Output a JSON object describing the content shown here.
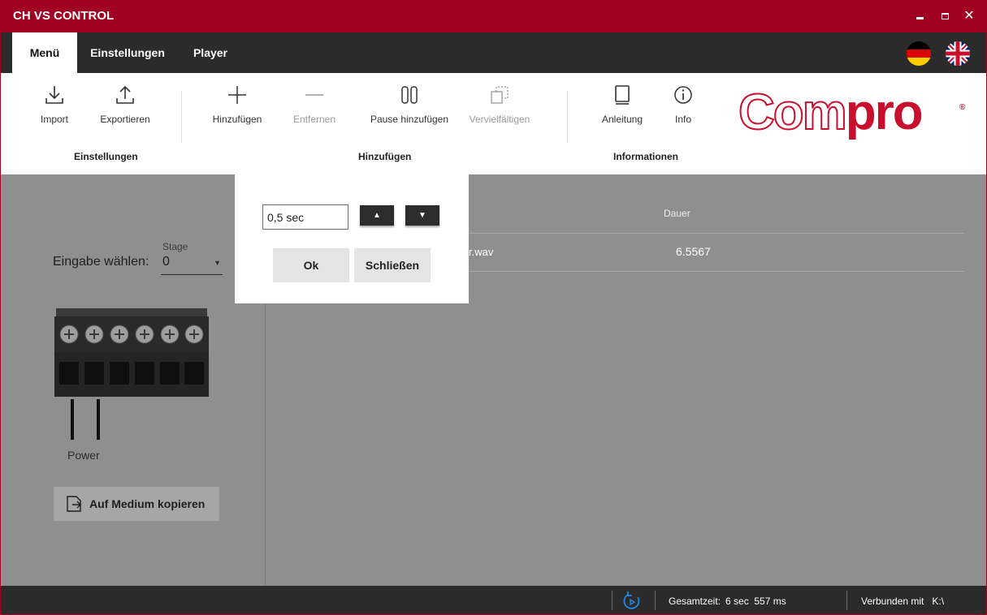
{
  "window": {
    "title": "CH VS CONTROL"
  },
  "tabs": [
    {
      "label": "Menü",
      "active": true
    },
    {
      "label": "Einstellungen",
      "active": false
    },
    {
      "label": "Player",
      "active": false
    }
  ],
  "languages": [
    {
      "icon": "flag-germany-icon"
    },
    {
      "icon": "flag-uk-icon"
    }
  ],
  "ribbon": {
    "groups": [
      {
        "label": "Einstellungen",
        "buttons": [
          {
            "label": "Import",
            "icon": "download-icon"
          },
          {
            "label": "Exportieren",
            "icon": "upload-icon"
          }
        ]
      },
      {
        "label": "Hinzufügen",
        "buttons": [
          {
            "label": "Hinzufügen",
            "icon": "plus-icon"
          },
          {
            "label": "Entfernen",
            "icon": "minus-icon",
            "disabled": true
          },
          {
            "label": "Pause hinzufügen",
            "icon": "pause-icon"
          },
          {
            "label": "Vervielfältigen",
            "icon": "duplicate-icon",
            "disabled": true
          }
        ]
      },
      {
        "label": "Informationen",
        "buttons": [
          {
            "label": "Anleitung",
            "icon": "book-icon"
          },
          {
            "label": "Info",
            "icon": "info-icon"
          }
        ]
      }
    ]
  },
  "logo": {
    "outline": "Com",
    "solid": "pro",
    "mark": "®"
  },
  "left_panel": {
    "stage_label": "Stage",
    "input_label": "Eingabe wählen:",
    "input_value": "0",
    "power_label": "Power",
    "copy_button": "Auf Medium kopieren"
  },
  "table": {
    "columns": [
      "Dauer"
    ],
    "rows": [
      {
        "name_fragment": "r.wav",
        "duration": "6.5567"
      }
    ]
  },
  "dialog": {
    "value": "0,5 sec",
    "up": "^",
    "down": "v",
    "ok": "Ok",
    "close": "Schließen"
  },
  "status": {
    "total_label": "Gesamtzeit:",
    "total_value": "6 sec  557 ms",
    "connected_label": "Verbunden mit",
    "connected_value": "K:\\"
  },
  "colors": {
    "accent": "#a00022",
    "logo": "#c8102e",
    "dark": "#2b2b2b",
    "panel": "#8f8f8f",
    "refresh": "#1e88e5"
  }
}
